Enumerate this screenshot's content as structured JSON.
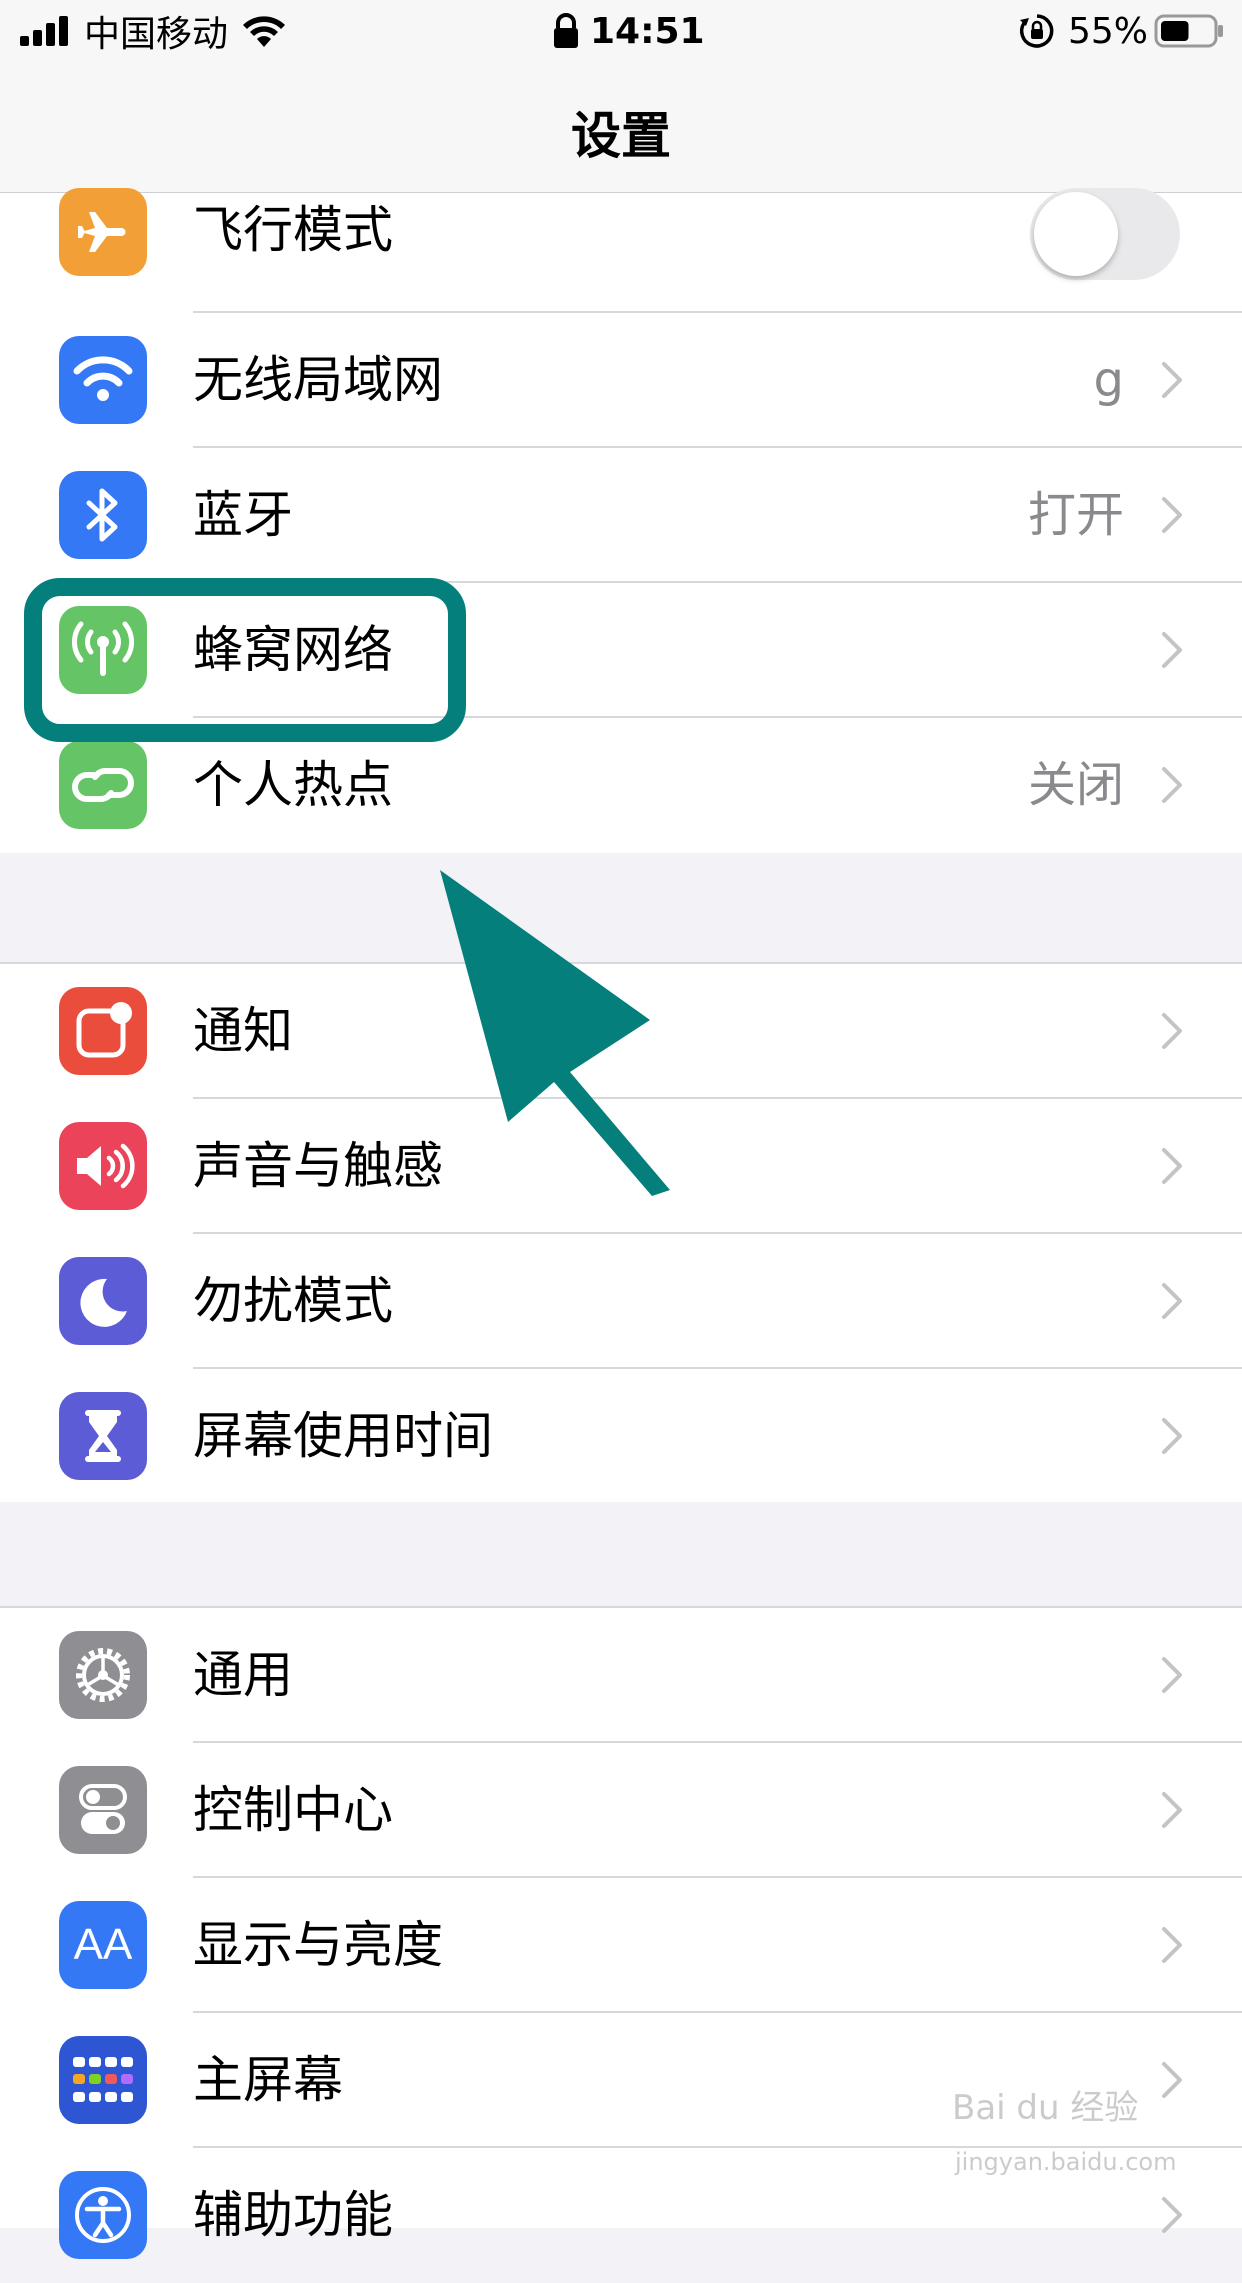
{
  "status": {
    "carrier": "中国移动",
    "time": "14:51",
    "battery": "55%",
    "battery_level": 0.55
  },
  "nav": {
    "title": "设置"
  },
  "groups": [
    {
      "items": [
        {
          "label": "飞行模式",
          "value": "",
          "toggle_on": false,
          "icon": "airplane-icon",
          "color": "#f29f38"
        },
        {
          "label": "无线局域网",
          "value": "g",
          "icon": "wifi-icon",
          "color": "#3478f6"
        },
        {
          "label": "蓝牙",
          "value": "打开",
          "icon": "bluetooth-icon",
          "color": "#3478f6"
        },
        {
          "label": "蜂窝网络",
          "value": "",
          "icon": "antenna-icon",
          "color": "#65c466"
        },
        {
          "label": "个人热点",
          "value": "关闭",
          "icon": "hotspot-icon",
          "color": "#65c466"
        }
      ]
    },
    {
      "items": [
        {
          "label": "通知",
          "value": "",
          "icon": "notification-icon",
          "color": "#eb4d3d"
        },
        {
          "label": "声音与触感",
          "value": "",
          "icon": "speaker-icon",
          "color": "#eb445a"
        },
        {
          "label": "勿扰模式",
          "value": "",
          "icon": "moon-icon",
          "color": "#5c5cd7"
        },
        {
          "label": "屏幕使用时间",
          "value": "",
          "icon": "hourglass-icon",
          "color": "#5c5cd7"
        }
      ]
    },
    {
      "items": [
        {
          "label": "通用",
          "value": "",
          "icon": "gear-icon",
          "color": "#8e8e93"
        },
        {
          "label": "控制中心",
          "value": "",
          "icon": "switches-icon",
          "color": "#8e8e93"
        },
        {
          "label": "显示与亮度",
          "value": "",
          "icon": "text-size-icon",
          "color": "#3478f6"
        },
        {
          "label": "主屏幕",
          "value": "",
          "icon": "home-grid-icon",
          "color": "#2f56d2"
        },
        {
          "label": "辅助功能",
          "value": "",
          "icon": "accessibility-icon",
          "color": "#3478f6"
        }
      ]
    }
  ],
  "icon_text": {
    "text_size": "AA"
  },
  "annotation_color": "#057f7c",
  "watermark": {
    "brand": "Bai du 经验",
    "url": "jingyan.baidu.com"
  }
}
